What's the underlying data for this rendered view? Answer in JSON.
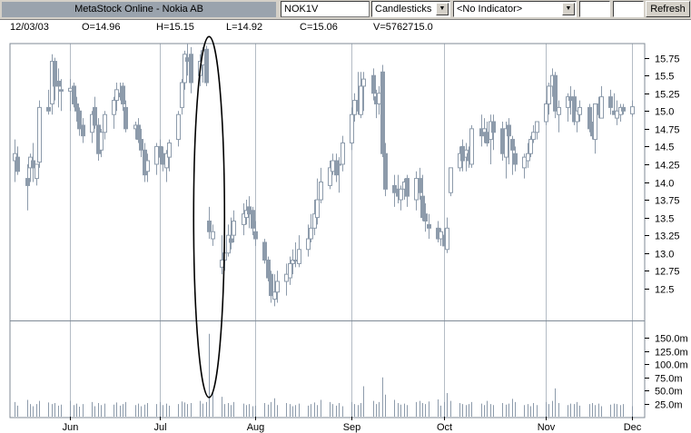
{
  "toolbar": {
    "title": "MetaStock Online - Nokia AB",
    "symbol": "NOK1V",
    "chart_type": "Candlesticks",
    "indicator": "<No Indicator>",
    "refresh_label": "Refresh"
  },
  "info": {
    "date": "12/03/03",
    "open": "O=14.96",
    "high": "H=15.15",
    "low": "L=14.92",
    "close": "C=15.06",
    "volume": "V=5762715.0"
  },
  "colors": {
    "candle": "#8d9bab",
    "grid": "#b4bcc5",
    "highlight_ellipse": "#000000"
  },
  "chart_data": [
    {
      "type": "candlestick",
      "title": "",
      "xlabel": "",
      "ylabel": "",
      "ylim": [
        12.05,
        15.95
      ],
      "y_ticks": [
        "12.5",
        "12.75",
        "13.0",
        "13.25",
        "13.5",
        "13.75",
        "14.0",
        "14.25",
        "14.5",
        "14.75",
        "15.0",
        "15.25",
        "15.5",
        "15.75"
      ],
      "x_ticks": [
        "Jun",
        "Jul",
        "Aug",
        "Sep",
        "Oct",
        "Nov",
        "Dec"
      ],
      "x_tick_dates": [
        "2003-06-02",
        "2003-07-01",
        "2003-08-01",
        "2003-09-01",
        "2003-10-01",
        "2003-11-03",
        "2003-12-01"
      ],
      "grid": true,
      "grid_axis": "x",
      "annotation": "ellipse around the mid-July gap-down candle and its volume spike",
      "highlight_date": "2003-07-17",
      "dates": [
        "2003-05-15",
        "2003-05-16",
        "2003-05-19",
        "2003-05-20",
        "2003-05-21",
        "2003-05-22",
        "2003-05-23",
        "2003-05-26",
        "2003-05-27",
        "2003-05-28",
        "2003-05-29",
        "2003-05-30",
        "2003-06-02",
        "2003-06-03",
        "2003-06-04",
        "2003-06-05",
        "2003-06-06",
        "2003-06-09",
        "2003-06-10",
        "2003-06-11",
        "2003-06-12",
        "2003-06-13",
        "2003-06-16",
        "2003-06-17",
        "2003-06-18",
        "2003-06-19",
        "2003-06-20",
        "2003-06-23",
        "2003-06-24",
        "2003-06-25",
        "2003-06-26",
        "2003-06-27",
        "2003-06-30",
        "2003-07-01",
        "2003-07-02",
        "2003-07-03",
        "2003-07-04",
        "2003-07-07",
        "2003-07-08",
        "2003-07-09",
        "2003-07-10",
        "2003-07-11",
        "2003-07-14",
        "2003-07-15",
        "2003-07-16",
        "2003-07-17",
        "2003-07-18",
        "2003-07-21",
        "2003-07-22",
        "2003-07-23",
        "2003-07-24",
        "2003-07-25",
        "2003-07-28",
        "2003-07-29",
        "2003-07-30",
        "2003-07-31",
        "2003-08-01",
        "2003-08-04",
        "2003-08-05",
        "2003-08-06",
        "2003-08-07",
        "2003-08-08",
        "2003-08-11",
        "2003-08-12",
        "2003-08-13",
        "2003-08-14",
        "2003-08-15",
        "2003-08-18",
        "2003-08-19",
        "2003-08-20",
        "2003-08-21",
        "2003-08-22",
        "2003-08-25",
        "2003-08-26",
        "2003-08-27",
        "2003-08-28",
        "2003-08-29",
        "2003-09-01",
        "2003-09-02",
        "2003-09-03",
        "2003-09-04",
        "2003-09-05",
        "2003-09-08",
        "2003-09-09",
        "2003-09-10",
        "2003-09-11",
        "2003-09-12",
        "2003-09-15",
        "2003-09-16",
        "2003-09-17",
        "2003-09-18",
        "2003-09-19",
        "2003-09-22",
        "2003-09-23",
        "2003-09-24",
        "2003-09-25",
        "2003-09-26",
        "2003-09-29",
        "2003-09-30",
        "2003-10-01",
        "2003-10-02",
        "2003-10-03",
        "2003-10-06",
        "2003-10-07",
        "2003-10-08",
        "2003-10-09",
        "2003-10-10",
        "2003-10-13",
        "2003-10-14",
        "2003-10-15",
        "2003-10-16",
        "2003-10-17",
        "2003-10-20",
        "2003-10-21",
        "2003-10-22",
        "2003-10-23",
        "2003-10-24",
        "2003-10-27",
        "2003-10-28",
        "2003-10-29",
        "2003-10-30",
        "2003-10-31",
        "2003-11-03",
        "2003-11-04",
        "2003-11-05",
        "2003-11-06",
        "2003-11-07",
        "2003-11-10",
        "2003-11-11",
        "2003-11-12",
        "2003-11-13",
        "2003-11-14",
        "2003-11-17",
        "2003-11-18",
        "2003-11-19",
        "2003-11-20",
        "2003-11-21",
        "2003-11-24",
        "2003-11-25",
        "2003-11-26",
        "2003-11-27",
        "2003-11-28",
        "2003-12-01",
        "2003-12-02",
        "2003-12-03"
      ],
      "open": [
        14.3,
        14.35,
        14.05,
        14.2,
        14.3,
        14.05,
        14.28,
        15.05,
        15.1,
        15.7,
        15.42,
        15.3,
        15.28,
        15.35,
        15.1,
        15.0,
        14.8,
        14.7,
        15.05,
        14.8,
        14.45,
        14.7,
        14.95,
        15.15,
        15.25,
        15.35,
        15.05,
        14.75,
        14.8,
        14.6,
        14.45,
        14.15,
        14.25,
        14.5,
        14.4,
        14.2,
        14.35,
        14.6,
        15.05,
        15.4,
        15.75,
        15.8,
        15.5,
        15.65,
        15.87,
        13.45,
        13.2,
        12.8,
        12.9,
        13.0,
        13.2,
        13.25,
        13.4,
        13.5,
        13.65,
        13.6,
        13.3,
        13.15,
        12.9,
        12.7,
        12.35,
        12.45,
        12.6,
        12.65,
        12.85,
        12.9,
        12.85,
        13.05,
        13.2,
        13.35,
        13.5,
        13.75,
        13.95,
        14.15,
        14.3,
        14.25,
        14.25,
        14.55,
        14.95,
        15.15,
        14.95,
        15.35,
        15.5,
        15.2,
        15.1,
        15.55,
        14.4,
        13.95,
        13.9,
        13.75,
        13.9,
        14.05,
        13.75,
        14.05,
        13.8,
        13.55,
        13.4,
        13.35,
        13.2,
        13.25,
        13.05,
        13.85,
        14.2,
        14.5,
        14.35,
        14.4,
        14.25,
        14.75,
        14.7,
        14.7,
        14.6,
        14.85,
        14.75,
        14.35,
        14.8,
        14.6,
        14.4,
        14.2,
        14.3,
        14.4,
        14.6,
        14.7,
        14.85,
        15.1,
        15.35,
        15.5,
        14.95,
        15.05,
        15.2,
        15.2,
        14.85,
        14.95,
        15.05,
        14.75,
        14.6,
        15.1,
        14.9,
        15.2,
        15.0,
        14.9,
        14.95,
        15.05,
        14.96
      ],
      "high": [
        14.6,
        14.5,
        14.25,
        14.4,
        14.55,
        14.25,
        15.15,
        15.3,
        15.8,
        15.75,
        15.6,
        15.45,
        15.45,
        15.4,
        15.2,
        15.05,
        14.9,
        15.0,
        15.2,
        14.9,
        14.75,
        15.0,
        15.2,
        15.4,
        15.4,
        15.4,
        15.15,
        14.85,
        14.9,
        14.75,
        14.55,
        14.4,
        14.55,
        14.6,
        14.5,
        14.45,
        14.6,
        15.0,
        15.45,
        15.85,
        15.95,
        15.9,
        15.8,
        15.9,
        15.92,
        13.65,
        13.4,
        13.25,
        13.3,
        13.4,
        13.5,
        13.6,
        13.7,
        13.75,
        13.8,
        13.65,
        13.45,
        13.2,
        12.95,
        12.75,
        12.7,
        12.75,
        12.85,
        12.95,
        13.05,
        13.15,
        13.25,
        13.4,
        13.55,
        13.75,
        14.05,
        14.2,
        14.3,
        14.4,
        14.4,
        14.35,
        14.65,
        15.05,
        15.25,
        15.55,
        15.55,
        15.55,
        15.6,
        15.3,
        15.35,
        15.65,
        14.55,
        14.1,
        14.1,
        13.95,
        14.05,
        14.1,
        14.15,
        14.2,
        14.1,
        13.7,
        13.55,
        13.45,
        13.35,
        13.35,
        13.5,
        14.15,
        14.5,
        14.6,
        14.55,
        14.5,
        14.8,
        14.95,
        14.9,
        14.85,
        14.95,
        14.95,
        14.85,
        14.85,
        14.9,
        14.65,
        14.5,
        14.4,
        14.55,
        14.65,
        14.8,
        14.85,
        15.15,
        15.4,
        15.6,
        15.55,
        15.15,
        15.25,
        15.35,
        15.3,
        15.0,
        15.15,
        15.1,
        14.85,
        14.95,
        15.2,
        15.35,
        15.3,
        15.25,
        15.15,
        15.1,
        15.1,
        15.15
      ],
      "low": [
        14.0,
        14.1,
        13.6,
        14.0,
        14.0,
        13.95,
        14.2,
        14.95,
        14.95,
        15.15,
        15.05,
        15.0,
        15.0,
        15.05,
        14.85,
        14.65,
        14.55,
        14.55,
        14.75,
        14.3,
        14.35,
        14.6,
        14.75,
        15.0,
        15.15,
        15.0,
        14.7,
        14.6,
        14.55,
        14.35,
        14.0,
        14.0,
        14.1,
        14.25,
        14.15,
        14.0,
        14.15,
        14.5,
        14.95,
        15.3,
        15.5,
        15.25,
        15.35,
        15.4,
        15.35,
        13.2,
        13.1,
        12.7,
        12.75,
        12.95,
        13.05,
        13.15,
        13.25,
        13.4,
        13.35,
        13.25,
        13.1,
        12.85,
        12.6,
        12.3,
        12.25,
        12.3,
        12.4,
        12.55,
        12.7,
        12.8,
        12.8,
        12.95,
        13.15,
        13.25,
        13.4,
        13.7,
        13.9,
        14.1,
        14.0,
        13.85,
        14.15,
        14.45,
        14.85,
        14.95,
        14.9,
        15.0,
        15.15,
        14.9,
        14.95,
        14.35,
        13.8,
        13.65,
        13.7,
        13.6,
        13.75,
        13.65,
        13.6,
        13.75,
        13.45,
        13.3,
        13.2,
        13.15,
        13.1,
        13.15,
        13.0,
        13.8,
        14.15,
        14.15,
        14.15,
        14.2,
        14.2,
        14.5,
        14.55,
        14.5,
        14.25,
        14.45,
        14.3,
        14.05,
        14.25,
        14.1,
        14.15,
        14.05,
        14.2,
        14.35,
        14.55,
        14.6,
        14.8,
        14.95,
        15.2,
        14.9,
        14.7,
        14.85,
        14.95,
        14.8,
        14.7,
        14.85,
        14.7,
        14.6,
        14.4,
        14.9,
        14.9,
        14.95,
        14.95,
        14.8,
        14.85,
        14.95,
        14.92
      ],
      "close": [
        14.4,
        14.15,
        13.95,
        14.35,
        14.2,
        14.25,
        15.05,
        15.0,
        15.7,
        15.35,
        15.35,
        15.28,
        15.32,
        15.1,
        15.0,
        14.75,
        14.65,
        14.95,
        14.8,
        14.4,
        14.7,
        14.95,
        15.15,
        15.3,
        15.2,
        15.1,
        14.75,
        14.8,
        14.6,
        14.45,
        14.1,
        14.3,
        14.5,
        14.35,
        14.25,
        14.4,
        14.55,
        14.95,
        15.4,
        15.8,
        15.7,
        15.4,
        15.7,
        15.85,
        15.4,
        13.3,
        13.3,
        12.9,
        13.0,
        13.25,
        13.15,
        13.45,
        13.55,
        13.6,
        13.55,
        13.35,
        13.2,
        12.9,
        12.65,
        12.4,
        12.45,
        12.6,
        12.7,
        12.85,
        12.9,
        12.9,
        13.05,
        13.2,
        13.35,
        13.55,
        13.75,
        14.0,
        14.2,
        14.3,
        14.1,
        14.25,
        14.55,
        14.95,
        15.15,
        15.0,
        15.35,
        15.45,
        15.25,
        15.1,
        15.25,
        14.4,
        13.9,
        13.85,
        13.8,
        13.9,
        14.0,
        13.8,
        14.05,
        13.85,
        13.5,
        13.45,
        13.35,
        13.2,
        13.3,
        13.1,
        13.35,
        14.2,
        14.4,
        14.3,
        14.45,
        14.3,
        14.75,
        14.65,
        14.75,
        14.55,
        14.85,
        14.7,
        14.4,
        14.75,
        14.65,
        14.45,
        14.25,
        14.35,
        14.4,
        14.6,
        14.7,
        14.85,
        15.1,
        15.35,
        15.5,
        15.0,
        15.05,
        15.2,
        15.15,
        14.85,
        15.0,
        15.05,
        14.75,
        14.65,
        15.1,
        14.95,
        15.2,
        15.05,
        14.95,
        15.0,
        15.05,
        15.0,
        15.06
      ],
      "volume_ylim": [
        0,
        175
      ],
      "volume_ticks": [
        "25.0m",
        "50.0m",
        "75.0m",
        "100.0m",
        "125.0m",
        "150.0m"
      ],
      "volume_m": [
        28,
        21,
        32,
        24,
        20,
        24,
        30,
        27,
        24,
        26,
        21,
        23,
        30,
        22,
        25,
        19,
        24,
        28,
        20,
        26,
        22,
        25,
        23,
        27,
        21,
        24,
        28,
        22,
        25,
        20,
        23,
        26,
        24,
        28,
        22,
        25,
        21,
        24,
        29,
        27,
        24,
        26,
        30,
        25,
        28,
        158,
        48,
        38,
        24,
        26,
        22,
        28,
        25,
        22,
        24,
        20,
        21,
        26,
        23,
        28,
        35,
        22,
        26,
        24,
        20,
        22,
        25,
        21,
        24,
        27,
        22,
        32,
        28,
        24,
        21,
        26,
        20,
        28,
        24,
        22,
        26,
        58,
        30,
        24,
        28,
        75,
        42,
        32,
        26,
        23,
        25,
        22,
        28,
        30,
        26,
        24,
        29,
        33,
        21,
        28,
        45,
        30,
        26,
        24,
        22,
        24,
        28,
        25,
        22,
        30,
        24,
        22,
        26,
        23,
        25,
        34,
        28,
        22,
        24,
        20,
        26,
        22,
        28,
        24,
        30,
        54,
        26,
        22,
        25,
        24,
        28,
        21,
        24,
        26,
        22,
        25,
        20,
        23,
        25,
        24,
        22,
        24,
        20
      ]
    }
  ]
}
